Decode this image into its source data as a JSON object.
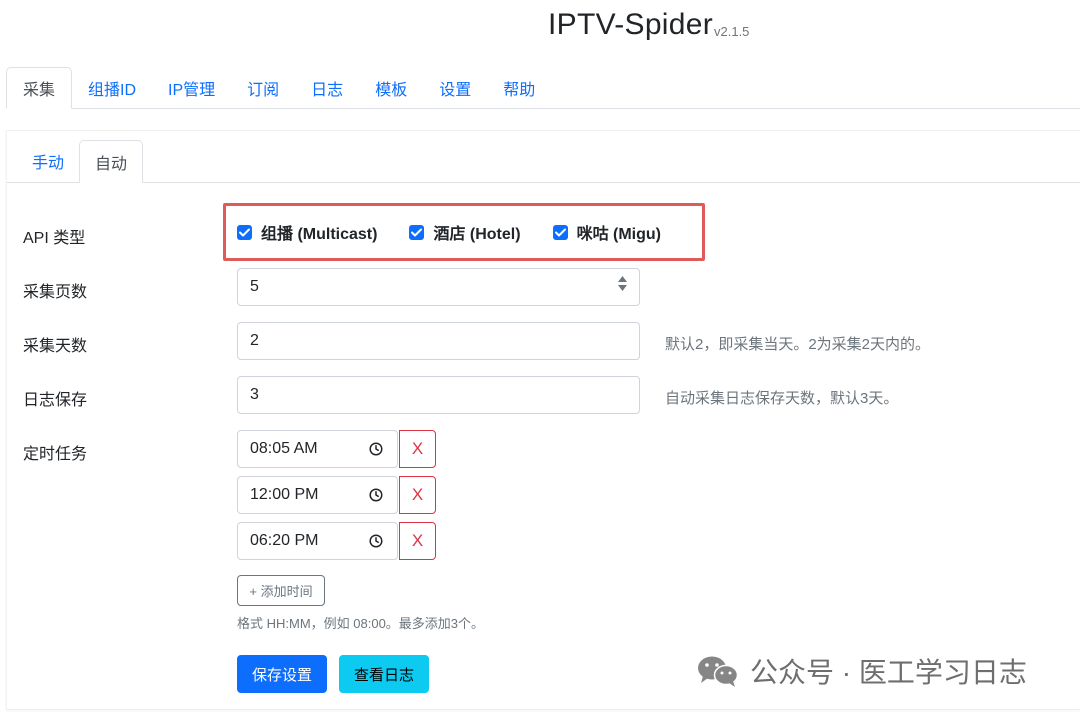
{
  "app": {
    "title": "IPTV-Spider",
    "version": "v2.1.5"
  },
  "main_tabs": [
    {
      "label": "采集",
      "active": true
    },
    {
      "label": "组播ID"
    },
    {
      "label": "IP管理"
    },
    {
      "label": "订阅"
    },
    {
      "label": "日志"
    },
    {
      "label": "模板"
    },
    {
      "label": "设置"
    },
    {
      "label": "帮助"
    }
  ],
  "sub_tabs": [
    {
      "label": "手动"
    },
    {
      "label": "自动",
      "active": true
    }
  ],
  "form": {
    "api_type": {
      "label": "API 类型",
      "options": [
        {
          "label": "组播 (Multicast)",
          "checked": true
        },
        {
          "label": "酒店 (Hotel)",
          "checked": true
        },
        {
          "label": "咪咕 (Migu)",
          "checked": true
        }
      ]
    },
    "pages": {
      "label": "采集页数",
      "value": "5"
    },
    "days": {
      "label": "采集天数",
      "value": "2",
      "help": "默认2，即采集当天。2为采集2天内的。"
    },
    "log_keep": {
      "label": "日志保存",
      "value": "3",
      "help": "自动采集日志保存天数，默认3天。"
    },
    "schedule": {
      "label": "定时任务",
      "times": [
        "08:05 AM",
        "12:00 PM",
        "06:20 PM"
      ],
      "delete_label": "X",
      "add_label": "+ 添加时间",
      "hint": "格式 HH:MM，例如 08:00。最多添加3个。"
    },
    "save_label": "保存设置",
    "view_log_label": "查看日志"
  },
  "watermark": {
    "text": "公众号 · 医工学习日志"
  },
  "colors": {
    "primary": "#0d6efd",
    "info": "#0dcaf0",
    "danger": "#dc3545",
    "highlight": "#e15a5a"
  }
}
